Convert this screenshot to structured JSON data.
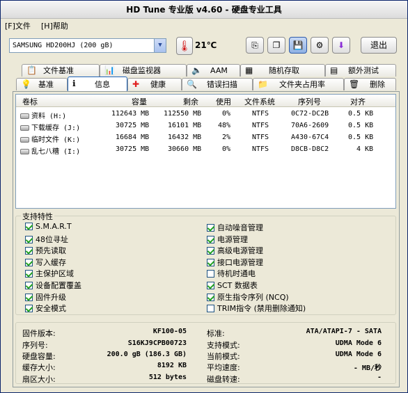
{
  "window": {
    "title": "HD Tune 专业版 v4.60 - 硬盘专业工具"
  },
  "menu": {
    "file": "[F]文件",
    "help": "[H]帮助"
  },
  "toolbar": {
    "drive": "SAMSUNG HD200HJ     (200 gB)",
    "temperature": "21℃",
    "exit_label": "退出"
  },
  "tabs_top": [
    {
      "label": "文件基准",
      "icon": "file-benchmark-icon"
    },
    {
      "label": "磁盘监视器",
      "icon": "disk-monitor-icon"
    },
    {
      "label": "AAM",
      "icon": "speaker-icon"
    },
    {
      "label": "随机存取",
      "icon": "random-access-icon"
    },
    {
      "label": "额外测试",
      "icon": "extra-tests-icon"
    }
  ],
  "tabs_bottom": [
    {
      "label": "基准",
      "icon": "benchmark-icon"
    },
    {
      "label": "信息",
      "icon": "info-icon"
    },
    {
      "label": "健康",
      "icon": "health-icon"
    },
    {
      "label": "错误扫描",
      "icon": "error-scan-icon"
    },
    {
      "label": "文件夹占用率",
      "icon": "folder-usage-icon"
    },
    {
      "label": "删除",
      "icon": "erase-icon"
    }
  ],
  "partitions": {
    "headers": [
      "卷标",
      "容量",
      "剩余",
      "使用",
      "文件系统",
      "序列号",
      "对齐"
    ],
    "rows": [
      [
        "资料  (H:)",
        "112643 MB",
        "112550 MB",
        "0%",
        "NTFS",
        "0C72-DC2B",
        "0.5 KB"
      ],
      [
        "下载缓存 (J:)",
        "30725 MB",
        "16101 MB",
        "48%",
        "NTFS",
        "70A6-2609",
        "0.5 KB"
      ],
      [
        "临时文件 (K:)",
        "16684 MB",
        "16432 MB",
        "2%",
        "NTFS",
        "A430-67C4",
        "0.5 KB"
      ],
      [
        "乱七八糟 (I:)",
        "30725 MB",
        "30660 MB",
        "0%",
        "NTFS",
        "D8CB-D8C2",
        "4 KB"
      ]
    ]
  },
  "features": {
    "title": "支持特性",
    "left": [
      {
        "label": "S.M.A.R.T",
        "checked": true
      },
      {
        "label": "48位寻址",
        "checked": true
      },
      {
        "label": "预先读取",
        "checked": true
      },
      {
        "label": "写入缓存",
        "checked": true
      },
      {
        "label": "主保护区域",
        "checked": true
      },
      {
        "label": "设备配置覆盖",
        "checked": true
      },
      {
        "label": "固件升级",
        "checked": true
      },
      {
        "label": "安全模式",
        "checked": true
      }
    ],
    "right": [
      {
        "label": "自动噪音管理",
        "checked": true
      },
      {
        "label": "电源管理",
        "checked": true
      },
      {
        "label": "高级电源管理",
        "checked": true
      },
      {
        "label": "接口电源管理",
        "checked": true
      },
      {
        "label": "待机时通电",
        "checked": false
      },
      {
        "label": "SCT 数据表",
        "checked": true
      },
      {
        "label": "原生指令序列 (NCQ)",
        "checked": true
      },
      {
        "label": "TRIM指令 (禁用删除通知)",
        "checked": false
      }
    ]
  },
  "info": {
    "left": [
      {
        "label": "固件版本:",
        "value": "KF100-05"
      },
      {
        "label": "序列号:",
        "value": "S16KJ9CPB00723"
      },
      {
        "label": "硬盘容量:",
        "value": "200.0 gB (186.3 GB)"
      },
      {
        "label": "缓存大小:",
        "value": "8192 KB"
      },
      {
        "label": "扇区大小:",
        "value": "512 bytes"
      }
    ],
    "right": [
      {
        "label": "标准:",
        "value": "ATA/ATAPI-7 - SATA"
      },
      {
        "label": "支持模式:",
        "value": "UDMA Mode 6"
      },
      {
        "label": "当前模式:",
        "value": "UDMA Mode 6"
      },
      {
        "label": "平均速度:",
        "value": "- MB/秒"
      },
      {
        "label": "磁盘转速:",
        "value": "-"
      }
    ]
  },
  "colors": {
    "accent": "#316ac5",
    "check": "#21a121",
    "thermo": "#d01010"
  }
}
